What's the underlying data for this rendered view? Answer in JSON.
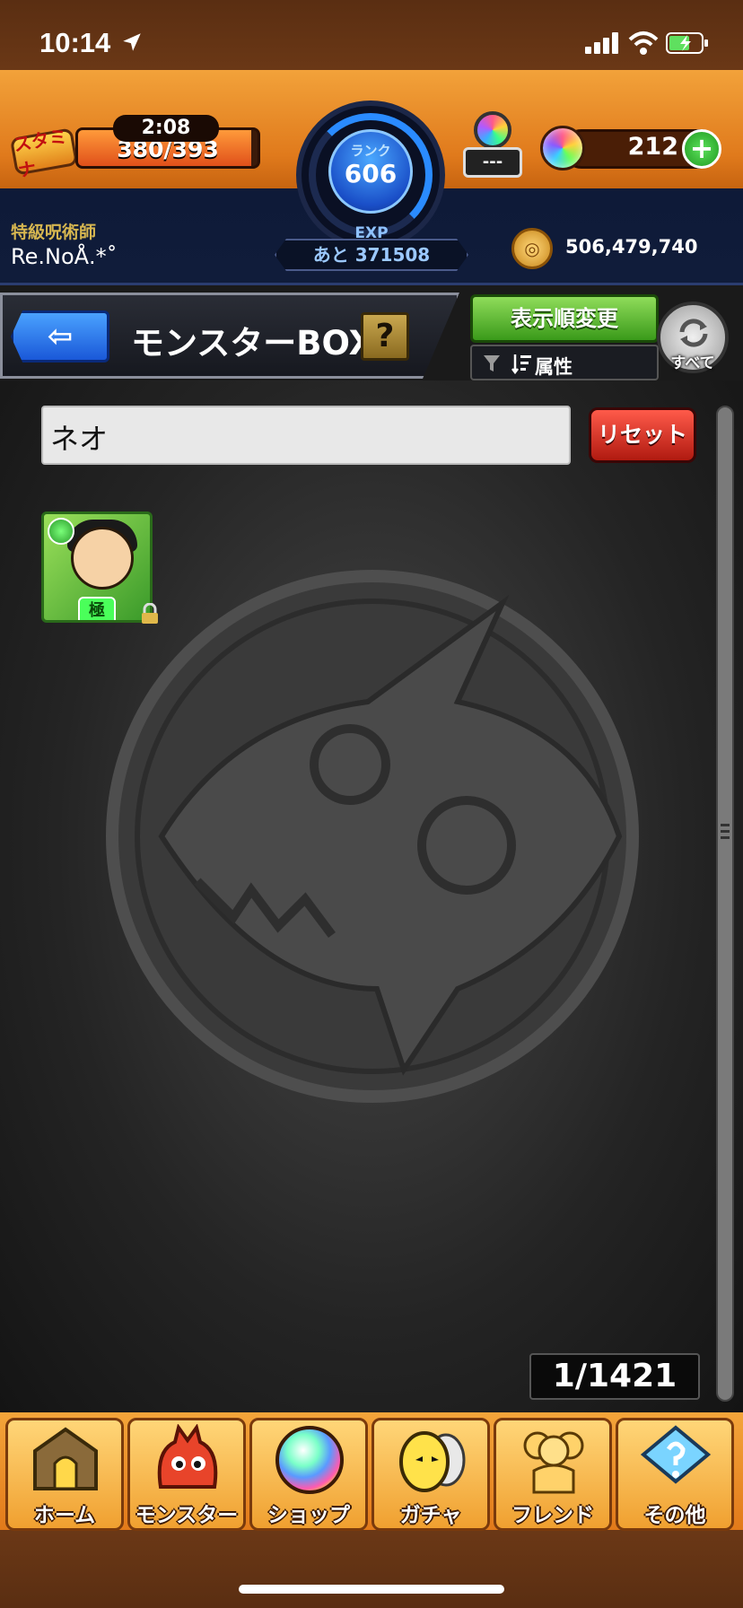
{
  "status_bar": {
    "time": "10:14"
  },
  "header": {
    "stamina_label": "スタミナ",
    "stamina_timer": "2:08",
    "stamina_value": "380/393",
    "stamina_fraction": 0.967,
    "rank_label": "ランク",
    "rank_value": "606",
    "exp_label": "EXP",
    "exp_remaining": "あと 371508",
    "orb_slot_value": "---",
    "orb_count": "212",
    "orb_plus": "+",
    "player_title": "特級呪術師",
    "player_name": "Re.NoÅ.*˚",
    "gold": "506,479,740"
  },
  "titlebar": {
    "back_icon": "⇦",
    "title": "モンスターBOX",
    "help": "?",
    "sort_button": "表示順変更",
    "filter_label": "属性",
    "all_label": "すべて"
  },
  "search": {
    "value": "ネオ",
    "reset_label": "リセット"
  },
  "monster": {
    "badge": "極"
  },
  "pager": {
    "count": "1/1421"
  },
  "bottom_nav": [
    {
      "label": "ホーム",
      "icon": "home-icon"
    },
    {
      "label": "モンスター",
      "icon": "monster-icon"
    },
    {
      "label": "ショップ",
      "icon": "shop-orb-icon"
    },
    {
      "label": "ガチャ",
      "icon": "gacha-egg-icon"
    },
    {
      "label": "フレンド",
      "icon": "friend-icon"
    },
    {
      "label": "その他",
      "icon": "other-icon"
    }
  ]
}
